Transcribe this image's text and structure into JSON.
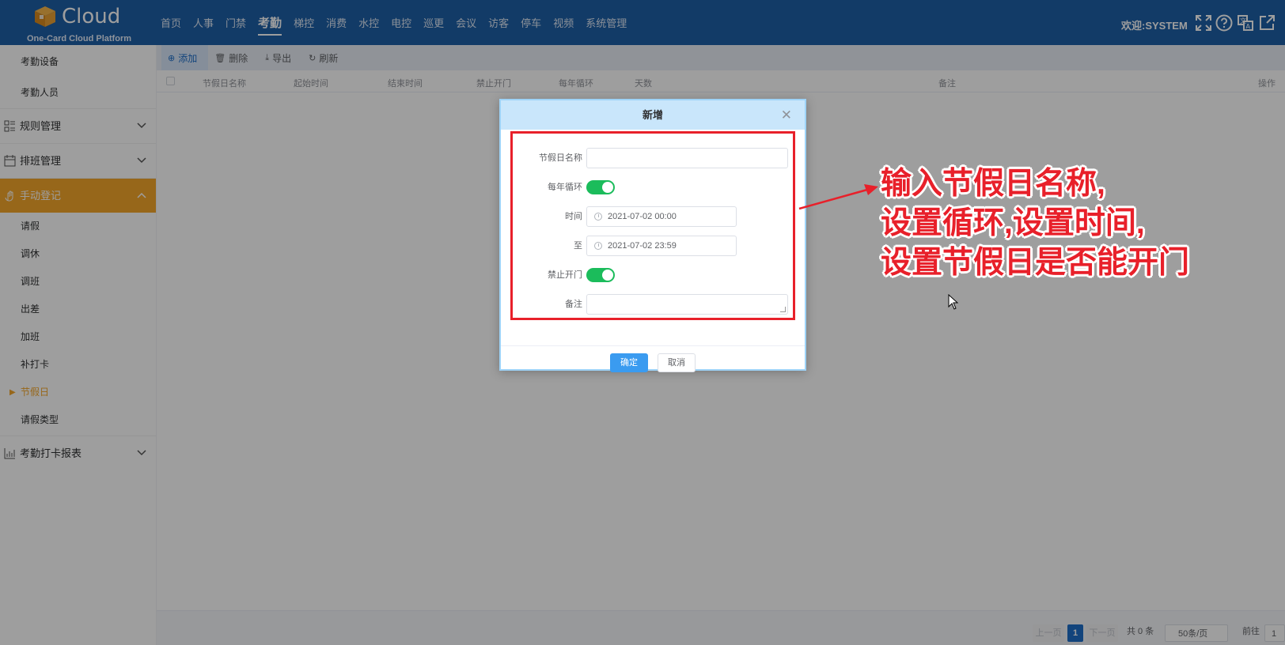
{
  "header": {
    "logo_text": "Cloud",
    "logo_sub": "One-Card Cloud Platform",
    "nav": [
      "首页",
      "人事",
      "门禁",
      "考勤",
      "梯控",
      "消费",
      "水控",
      "电控",
      "巡更",
      "会议",
      "访客",
      "停车",
      "视频",
      "系统管理"
    ],
    "active_nav": "考勤",
    "welcome": "欢迎:SYSTEM",
    "icons": [
      "fullscreen-icon",
      "help-icon",
      "translate-icon",
      "external-link-icon"
    ]
  },
  "sidebar": {
    "top_items": [
      "考勤设备",
      "考勤人员"
    ],
    "groups": [
      {
        "label": "规则管理",
        "icon": "rules-icon"
      },
      {
        "label": "排班管理",
        "icon": "schedule-icon"
      },
      {
        "label": "手动登记",
        "icon": "hand-icon"
      }
    ],
    "sub_items": [
      "请假",
      "调休",
      "调班",
      "出差",
      "加班",
      "补打卡",
      "节假日",
      "请假类型"
    ],
    "current_item": "节假日",
    "report_group": {
      "label": "考勤打卡报表",
      "icon": "chart-icon"
    }
  },
  "toolbar": {
    "add": "添加",
    "delete": "删除",
    "export": "导出",
    "refresh": "刷新"
  },
  "table": {
    "columns": [
      "节假日名称",
      "起始时间",
      "结束时间",
      "禁止开门",
      "每年循环",
      "天数",
      "备注",
      "操作"
    ]
  },
  "pagination": {
    "prev": "上一页",
    "current": "1",
    "next": "下一页",
    "total": "共 0 条",
    "page_size": "50条/页",
    "goto_label": "前往",
    "goto_value": "1"
  },
  "dialog": {
    "title": "新增",
    "name_label": "节假日名称",
    "name_value": "",
    "cycle_label": "每年循环",
    "cycle_on": true,
    "time_label": "时间",
    "time_start": "2021-07-02 00:00",
    "to_label": "至",
    "time_end": "2021-07-02 23:59",
    "forbid_label": "禁止开门",
    "forbid_on": true,
    "remark_label": "备注",
    "ok": "确定",
    "cancel": "取消"
  },
  "annotation": {
    "line1": "输入节假日名称,",
    "line2": "设置循环,设置时间,",
    "line3": "设置节假日是否能开门",
    "color": "#e8202a"
  },
  "colors": {
    "header": "#1e5fa6",
    "accent": "#f4a62a",
    "primary": "#3a9bf0",
    "switch_on": "#1bbc5b"
  }
}
